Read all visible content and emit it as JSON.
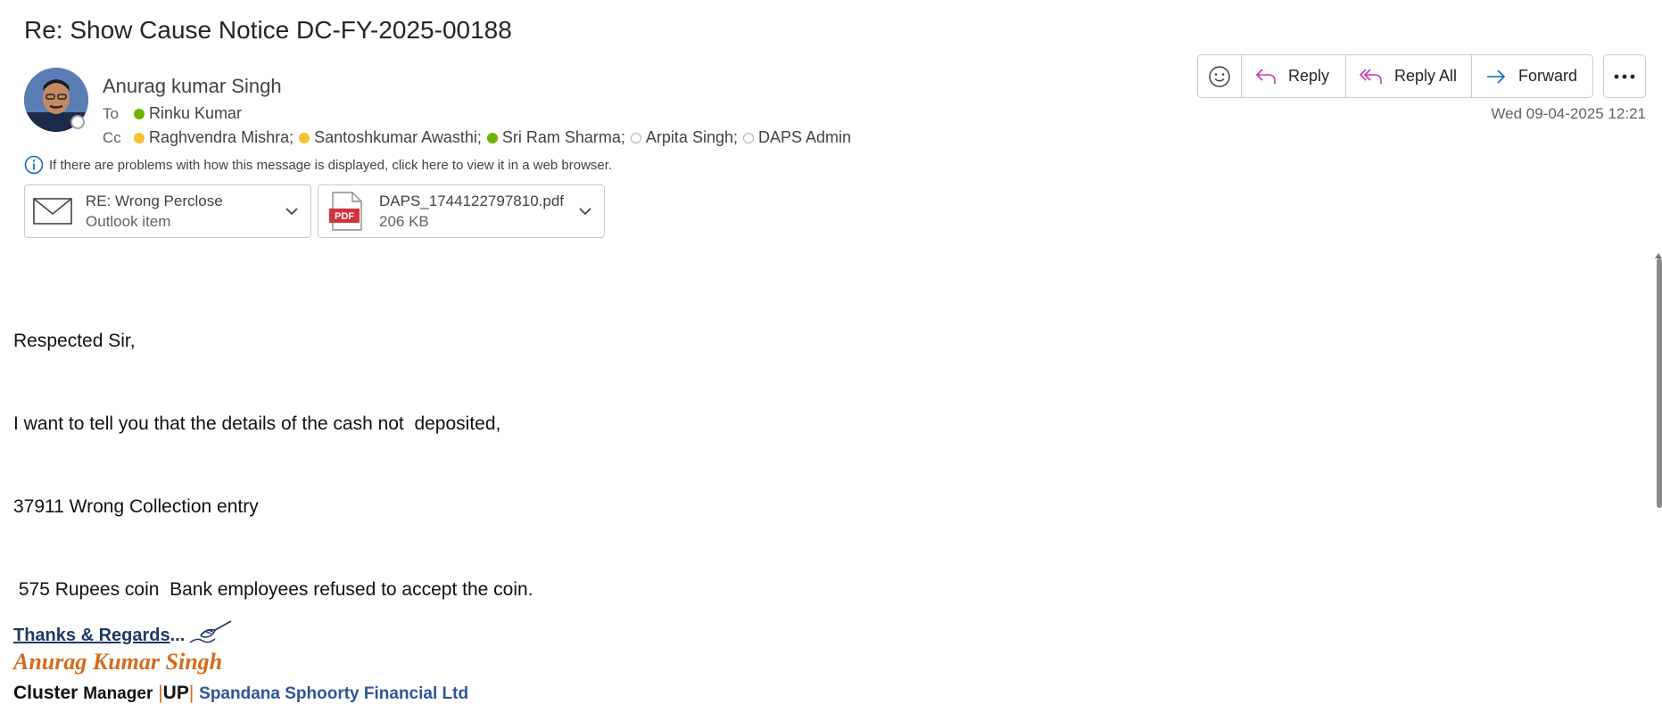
{
  "subject": "Re: Show Cause Notice DC-FY-2025-00188",
  "sender": {
    "name": "Anurag kumar Singh"
  },
  "to": {
    "label": "To",
    "recipients": [
      {
        "name": "Rinku Kumar",
        "status": "available"
      }
    ]
  },
  "cc": {
    "label": "Cc",
    "recipients": [
      {
        "name": "Raghvendra Mishra;",
        "status": "away"
      },
      {
        "name": "Santoshkumar Awasthi;",
        "status": "away"
      },
      {
        "name": "Sri Ram Sharma;",
        "status": "available"
      },
      {
        "name": "Arpita Singh;",
        "status": "offline"
      },
      {
        "name": "DAPS Admin",
        "status": "offline"
      }
    ]
  },
  "info_bar": "If there are problems with how this message is displayed, click here to view it in a web browser.",
  "attachments": [
    {
      "name": "RE: Wrong Perclose",
      "detail": "Outlook item",
      "icon": "mail-icon"
    },
    {
      "name": "DAPS_1744122797810.pdf",
      "detail": "206 KB",
      "icon": "pdf-icon",
      "icon_label": "PDF"
    }
  ],
  "toolbar": {
    "reply": "Reply",
    "reply_all": "Reply All",
    "forward": "Forward"
  },
  "date": "Wed 09-04-2025 12:21",
  "body_lines": [
    "Respected Sir,",
    "I want to tell you that the details of the cash not  deposited,",
    "37911 Wrong Collection entry",
    " 575 Rupees coin  Bank employees refused to accept the coin."
  ],
  "signature": {
    "thanks": "Thanks & Regards",
    "thanks_suffix": "...",
    "name": "Anurag Kumar Singh",
    "title_cluster": "Cluster",
    "title_manager": "Manager",
    "sep1": "|",
    "region": "UP",
    "sep2": "|",
    "company": "Spandana Sphoorty Financial Ltd"
  },
  "colors": {
    "available": "#6bb700",
    "away": "#f8c02e",
    "reply_icon": "#c239b3",
    "forward_icon": "#0f6cbd",
    "signature_name": "#d46b1c",
    "signature_link": "#1f3864"
  }
}
